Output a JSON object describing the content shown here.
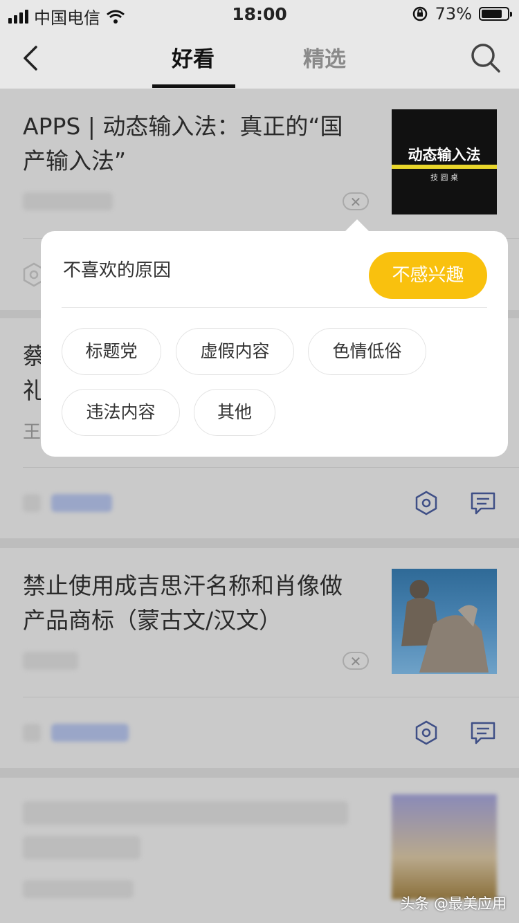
{
  "status_bar": {
    "carrier": "中国电信",
    "time": "18:00",
    "battery": "73%",
    "battery_level": 0.73
  },
  "nav": {
    "tabs": [
      {
        "label": "好看",
        "active": true
      },
      {
        "label": "精选",
        "active": false
      }
    ]
  },
  "articles": [
    {
      "title_line1": "APPS | 动态输入法：真正的“国",
      "title_line2": "产输入法”",
      "thumb_text": "动态输入法",
      "thumb_sub": "技  圆  桌"
    },
    {
      "title_line1": "蔡",
      "title_line2": "礼",
      "author": "王"
    },
    {
      "title_line1": "禁止使用成吉思汗名称和肖像做",
      "title_line2": "产品商标（蒙古文/汉文）"
    }
  ],
  "popup": {
    "title": "不喜欢的原因",
    "action": "不感兴趣",
    "reasons": [
      "标题党",
      "虚假内容",
      "色情低俗",
      "违法内容",
      "其他"
    ]
  },
  "watermark": "头条 @最美应用",
  "colors": {
    "accent": "#f9c10e",
    "icon": "#3f4f86"
  }
}
